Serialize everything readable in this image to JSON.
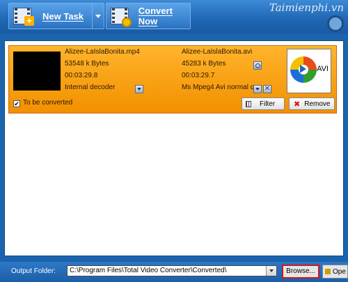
{
  "toolbar": {
    "new_task_label": "New Task",
    "convert_now_label": "Convert Now"
  },
  "watermark": "Taimienphi.vn",
  "task": {
    "source": {
      "filename": "Alizee-LaIslaBonita.mp4",
      "size": "53548 k Bytes",
      "duration": "00:03:29.8",
      "decoder": "Internal decoder"
    },
    "output": {
      "filename": "Alizee-LaIslaBonita.avi",
      "size": "45283 k Bytes",
      "duration": "00:03:29.7",
      "profile": "Ms Mpeg4 Avi normal q"
    },
    "format_label": "AVI",
    "checkbox_label": "To be converted",
    "checked": true,
    "filter_label": "Filter",
    "remove_label": "Remove"
  },
  "bottom": {
    "output_folder_label": "Output Folder:",
    "output_path": "C:\\Program Files\\Total Video Converter\\Converted\\",
    "browse_label": "Browse...",
    "open_label": "Ope"
  },
  "colors": {
    "background": "#1b63ad",
    "task_orange": "#f5a11a",
    "highlight_red": "#d11a1a"
  }
}
